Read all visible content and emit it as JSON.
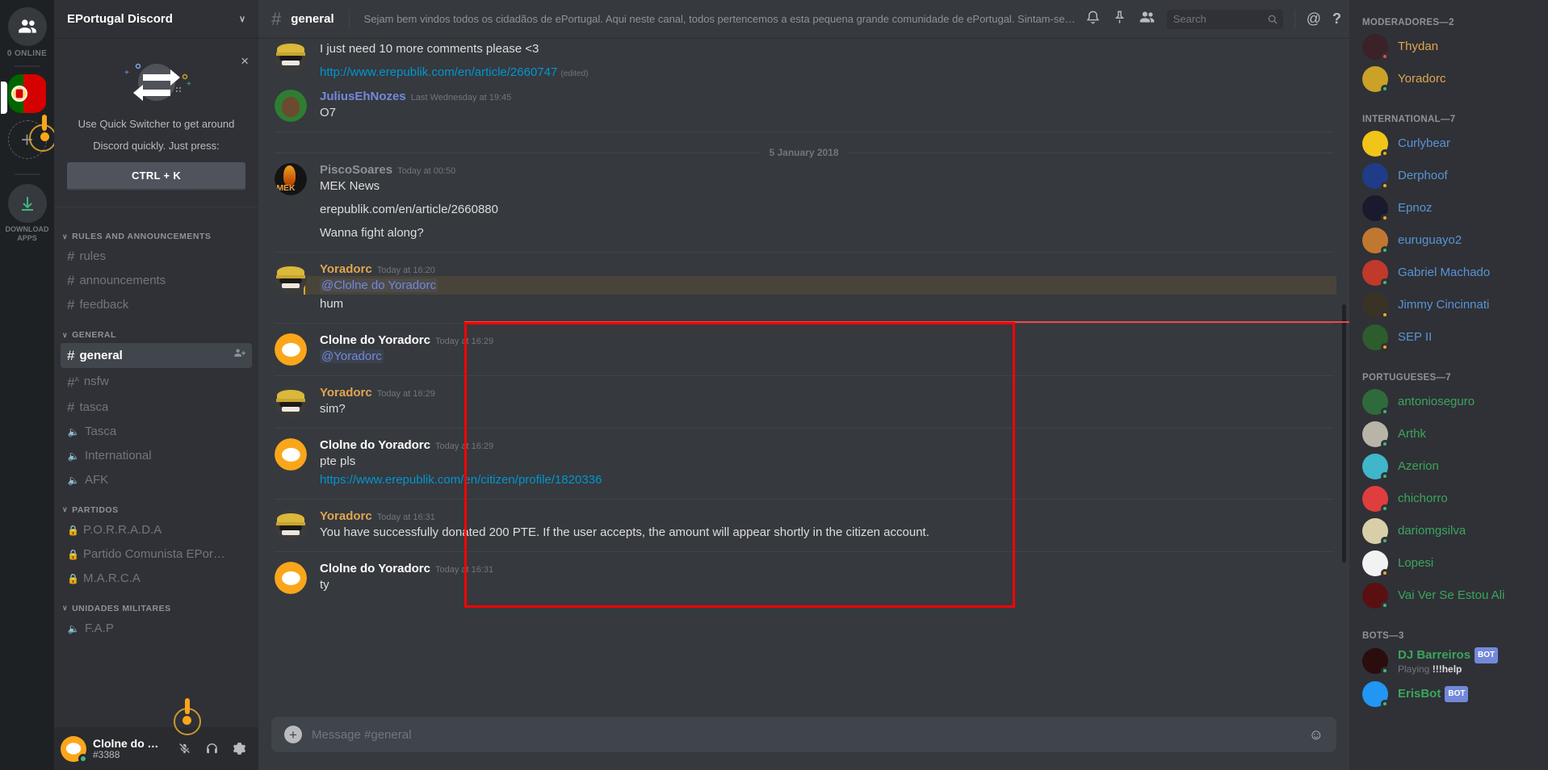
{
  "guild_rail": {
    "home_icon": "friends-icon",
    "online_label": "0 ONLINE",
    "server_name": "ePortugal",
    "add_server_label": "+",
    "download_label": "DOWNLOAD APPS"
  },
  "sidebar": {
    "guild_title": "EPortugal Discord",
    "chevron": "∨",
    "quick_switcher": {
      "close": "×",
      "text_line1": "Use Quick Switcher to get around",
      "text_line2": "Discord quickly. Just press:",
      "key": "CTRL + K"
    },
    "categories": [
      {
        "label": "RULES AND ANNOUNCEMENTS",
        "channels": [
          {
            "name": "rules",
            "type": "text"
          },
          {
            "name": "announcements",
            "type": "text"
          },
          {
            "name": "feedback",
            "type": "text"
          }
        ]
      },
      {
        "label": "GENERAL",
        "channels": [
          {
            "name": "general",
            "type": "text",
            "active": true
          },
          {
            "name": "nsfw",
            "type": "text-nsfw"
          },
          {
            "name": "tasca",
            "type": "text"
          },
          {
            "name": "Tasca",
            "type": "voice"
          },
          {
            "name": "International",
            "type": "voice"
          },
          {
            "name": "AFK",
            "type": "voice"
          }
        ]
      },
      {
        "label": "PARTIDOS",
        "channels": [
          {
            "name": "P.O.R.R.A.D.A",
            "type": "locked"
          },
          {
            "name": "Partido Comunista EPortu...",
            "type": "locked"
          },
          {
            "name": "M.A.R.C.A",
            "type": "locked"
          }
        ]
      },
      {
        "label": "UNIDADES MILITARES",
        "channels": [
          {
            "name": "F.A.P",
            "type": "voice"
          }
        ]
      }
    ],
    "user": {
      "name": "Clolne do Yo...",
      "discriminator": "#3388",
      "mute_icon": "microphone-muted-icon",
      "deafen_icon": "headphones-icon",
      "settings_icon": "gear-icon"
    }
  },
  "topbar": {
    "hash": "#",
    "channel": "general",
    "topic": "Sejam bem vindos todos os cidadãos de ePortugal. Aqui neste canal, todos pertencemos a esta pequena grande comunidade de ePortugal. Sintam-se em casa! Irão rapidamente aperceber-se que a...",
    "icons": {
      "bell": "bell-icon",
      "pin": "pin-icon",
      "members": "members-icon",
      "mention": "@",
      "help": "?"
    },
    "search_placeholder": "Search"
  },
  "messages": [
    {
      "id": "m0",
      "type": "grouped",
      "avatar": "yoradorc",
      "lines": [
        {
          "kind": "text",
          "text": "I just need 10 more comments please <3"
        },
        {
          "kind": "link-edited",
          "link": "http://www.erepublik.com/en/article/2660747",
          "edited": "(edited)"
        }
      ]
    },
    {
      "id": "m1",
      "type": "full",
      "avatar": "julius",
      "author": "JuliusEhNozes",
      "author_color": "#7289da",
      "time": "Last Wednesday at 19:45",
      "lines": [
        {
          "kind": "text",
          "text": "O7"
        }
      ]
    },
    {
      "id": "divider",
      "type": "date-divider",
      "label": "5 January 2018"
    },
    {
      "id": "m2",
      "type": "full",
      "avatar": "pisco",
      "author": "PiscoSoares",
      "author_color": "#8e9297",
      "time": "Today at 00:50",
      "lines": [
        {
          "kind": "text",
          "text": "MEK News"
        },
        {
          "kind": "text-spaced",
          "text": "erepublik.com/en/article/2660880"
        },
        {
          "kind": "text-spaced",
          "text": "Wanna fight along?"
        }
      ]
    },
    {
      "id": "m3",
      "type": "full",
      "avatar": "yoradorc",
      "author": "Yoradorc",
      "author_color": "#e0a650",
      "time": "Today at 16:20",
      "lines": [
        {
          "kind": "mention",
          "text": "@Clolne do Yoradorc"
        },
        {
          "kind": "text",
          "text": "hum"
        }
      ]
    },
    {
      "id": "m4",
      "type": "full",
      "avatar": "clone",
      "author": "Clolne do Yoradorc",
      "author_color": "#ffffff",
      "time": "Today at 16:29",
      "lines": [
        {
          "kind": "mention-plain",
          "text": "@Yoradorc"
        }
      ]
    },
    {
      "id": "m5",
      "type": "full",
      "avatar": "yoradorc",
      "author": "Yoradorc",
      "author_color": "#e0a650",
      "time": "Today at 16:29",
      "lines": [
        {
          "kind": "text",
          "text": "sim?"
        }
      ]
    },
    {
      "id": "m6",
      "type": "full",
      "avatar": "clone",
      "author": "Clolne do Yoradorc",
      "author_color": "#ffffff",
      "time": "Today at 16:29",
      "lines": [
        {
          "kind": "text",
          "text": "pte pls"
        },
        {
          "kind": "link",
          "text": "https://www.erepublik.com/en/citizen/profile/1820336"
        }
      ]
    },
    {
      "id": "m7",
      "type": "full",
      "avatar": "yoradorc",
      "author": "Yoradorc",
      "author_color": "#e0a650",
      "time": "Today at 16:31",
      "lines": [
        {
          "kind": "text",
          "text": "You have successfully donated 200 PTE. If the user accepts, the amount will appear shortly in the citizen account."
        }
      ]
    },
    {
      "id": "m8",
      "type": "full",
      "avatar": "clone",
      "author": "Clolne do Yoradorc",
      "author_color": "#ffffff",
      "time": "Today at 16:31",
      "lines": [
        {
          "kind": "text",
          "text": "ty"
        }
      ]
    }
  ],
  "composer": {
    "plus": "+",
    "placeholder": "Message #general",
    "emoji": "☺"
  },
  "members": {
    "groups": [
      {
        "label": "MODERADORES—2",
        "people": [
          {
            "name": "Thydan",
            "color": "#e0a650",
            "status": "dnd",
            "avatar": "#3a2228"
          },
          {
            "name": "Yoradorc",
            "color": "#e0a650",
            "status": "online",
            "avatar": "#c9a227"
          }
        ]
      },
      {
        "label": "INTERNATIONAL—7",
        "people": [
          {
            "name": "Curlybear",
            "color": "#5a93d4",
            "status": "idle",
            "avatar": "#f0c419"
          },
          {
            "name": "Derphoof",
            "color": "#5a93d4",
            "status": "idle",
            "avatar": "#1f3c88"
          },
          {
            "name": "Epnoz",
            "color": "#5a93d4",
            "status": "idle",
            "avatar": "#1a1a2e"
          },
          {
            "name": "euruguayo2",
            "color": "#5a93d4",
            "status": "online",
            "avatar": "#c07830"
          },
          {
            "name": "Gabriel Machado",
            "color": "#5a93d4",
            "status": "online",
            "avatar": "#c0392b"
          },
          {
            "name": "Jimmy Cincinnati",
            "color": "#5a93d4",
            "status": "idle",
            "avatar": "#3a3325"
          },
          {
            "name": "SEP II",
            "color": "#5a93d4",
            "status": "idle",
            "avatar": "#2d5c2d"
          }
        ]
      },
      {
        "label": "PORTUGUESES—7",
        "people": [
          {
            "name": "antonioseguro",
            "color": "#3ba55c",
            "status": "online",
            "avatar": "#2f6b3a"
          },
          {
            "name": "Arthk",
            "color": "#3ba55c",
            "status": "online",
            "avatar": "#b9b4a8"
          },
          {
            "name": "Azerion",
            "color": "#3ba55c",
            "status": "online",
            "avatar": "#3fb6c9"
          },
          {
            "name": "chichorro",
            "color": "#3ba55c",
            "status": "online",
            "avatar": "#e03e3e"
          },
          {
            "name": "dariomgsilva",
            "color": "#3ba55c",
            "status": "online",
            "avatar": "#d8cfa8"
          },
          {
            "name": "Lopesi",
            "color": "#3ba55c",
            "status": "idle",
            "avatar": "#f2f2f2"
          },
          {
            "name": "Vai Ver Se Estou Ali",
            "color": "#3ba55c",
            "status": "online",
            "avatar": "#5a1010"
          }
        ]
      },
      {
        "label": "BOTS—3",
        "people": [
          {
            "name": "DJ Barreiros",
            "color": "#3ba55c",
            "status": "online",
            "avatar": "#2b0d0d",
            "bot": "BOT",
            "sub_prefix": "Playing ",
            "sub_bold": "!!!help"
          },
          {
            "name": "ErisBot",
            "color": "#3ba55c",
            "status": "online",
            "avatar": "#2196f3",
            "bot": "BOT"
          }
        ]
      }
    ]
  },
  "colors": {
    "brand": "#7289da",
    "bg_main": "#36393e",
    "bg_sidebar": "#2f3136",
    "bg_rail": "#1e2124",
    "highlight_red": "#ff0000",
    "unread_red": "#f04747",
    "link": "#0096cf",
    "mention_yellow": "#faa61a"
  }
}
